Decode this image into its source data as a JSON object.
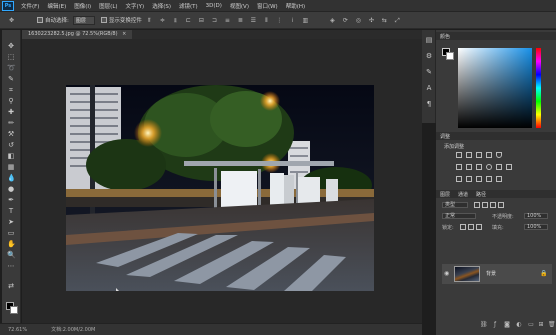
{
  "app": {
    "logo": "Ps"
  },
  "menu": [
    "文件(F)",
    "编辑(E)",
    "图像(I)",
    "图层(L)",
    "文字(Y)",
    "选择(S)",
    "滤镜(T)",
    "3D(D)",
    "视图(V)",
    "窗口(W)",
    "帮助(H)"
  ],
  "options": {
    "auto_select_label": "自动选择:",
    "auto_select_value": "图层",
    "transform_label": "显示变换控件"
  },
  "document": {
    "tab_title": "1630223282.5.jpg @ 72.5%(RGB/8)",
    "close_glyph": "×"
  },
  "status": {
    "zoom": "72.61%",
    "doc_size": "文档:2.00M/2.00M"
  },
  "panels": {
    "color_tabs": [
      "颜色"
    ],
    "adjust_tabs": [
      "调整"
    ],
    "adjust_title": "添加调整",
    "layers_tabs": [
      "图层",
      "通道",
      "路径"
    ],
    "kind_label": "类型",
    "blend_mode": "正常",
    "opacity_label": "不透明度:",
    "opacity_value": "100%",
    "lock_label": "锁定:",
    "fill_label": "填充:",
    "fill_value": "100%",
    "layer_name": "背景"
  },
  "colors": {
    "accent": "#31a8ff",
    "workspace": "#282828",
    "panel": "#3a3a3a"
  }
}
